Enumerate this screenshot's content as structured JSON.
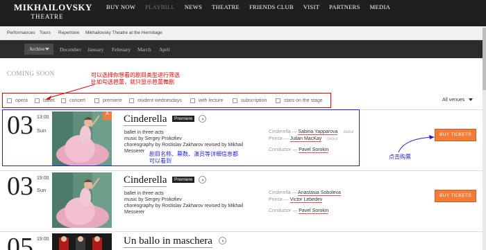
{
  "header": {
    "logo_line1": "MIKHAILOVSKY",
    "logo_line2": "THEATRE",
    "nav": [
      "BUY NOW",
      "PLAYBILL",
      "NEWS",
      "THEATRE",
      "FRIENDS CLUB",
      "VISIT",
      "PARTNERS",
      "MEDIA"
    ]
  },
  "subnav": [
    "Performances",
    "Tours",
    "Repertoire",
    "Mikhailovsky Theatre at the Hermitage"
  ],
  "monthbar": {
    "archive": "Archive",
    "months": [
      "December",
      "January",
      "February",
      "March",
      "April"
    ]
  },
  "coming_soon": "COMING SOON",
  "annotations": {
    "filter_note_line1": "可以选择你想看的剧目类型进行筛选",
    "filter_note_line2": "比如勾选芭蕾，就只显示芭蕾舞剧",
    "detail_note_line1": "剧目名称、幕数、演员等详细信息都",
    "detail_note_line2": "可以看到",
    "buy_note": "点击购票"
  },
  "filters": [
    "opera",
    "ballet",
    "concert",
    "premiere",
    "student wednesdays",
    "with lecture",
    "subscription",
    "stars on the stage"
  ],
  "venue_select": "All venues",
  "events": [
    {
      "day": "03",
      "time": "13:00",
      "weekday": "Sun",
      "title": "Cinderella",
      "badge": "Premiere",
      "age_badge": "A",
      "desc1": "ballet in three acts",
      "desc2": "music by Sergey Prokofiev",
      "desc3": "choreography by Rostislav Zakharov revised by Mikhail",
      "desc4": "Messerer",
      "cast": [
        {
          "role": "Cinderella",
          "name": "Sabina Yapparova",
          "note": "debut"
        },
        {
          "role": "Prince",
          "name": "Julian MacKay",
          "note": "debut"
        },
        {
          "role": "Conductor",
          "name": "Pavel Sorokin",
          "note": ""
        }
      ],
      "buy": "BUY TICKETS"
    },
    {
      "day": "03",
      "time": "19:00",
      "weekday": "Sun",
      "title": "Cinderella",
      "badge": "Premiere",
      "desc1": "ballet in three acts",
      "desc2": "music by Sergey Prokofiev",
      "desc3": "choreography by Rostislav Zakharov revised by Mikhail",
      "desc4": "Messerer",
      "cast": [
        {
          "role": "Cinderella",
          "name": "Anastasia Soboleva",
          "note": ""
        },
        {
          "role": "Prince",
          "name": "Victor Lebedev",
          "note": ""
        },
        {
          "role": "Conductor",
          "name": "Pavel Sorokin",
          "note": ""
        }
      ],
      "buy": "BUY TICKETS"
    },
    {
      "day": "05",
      "time": "19:00",
      "weekday": "",
      "title": "Un ballo in maschera"
    }
  ],
  "colors": {
    "accent": "#f07d3a",
    "annotation_red": "#e00000",
    "annotation_blue": "#2222cc"
  }
}
